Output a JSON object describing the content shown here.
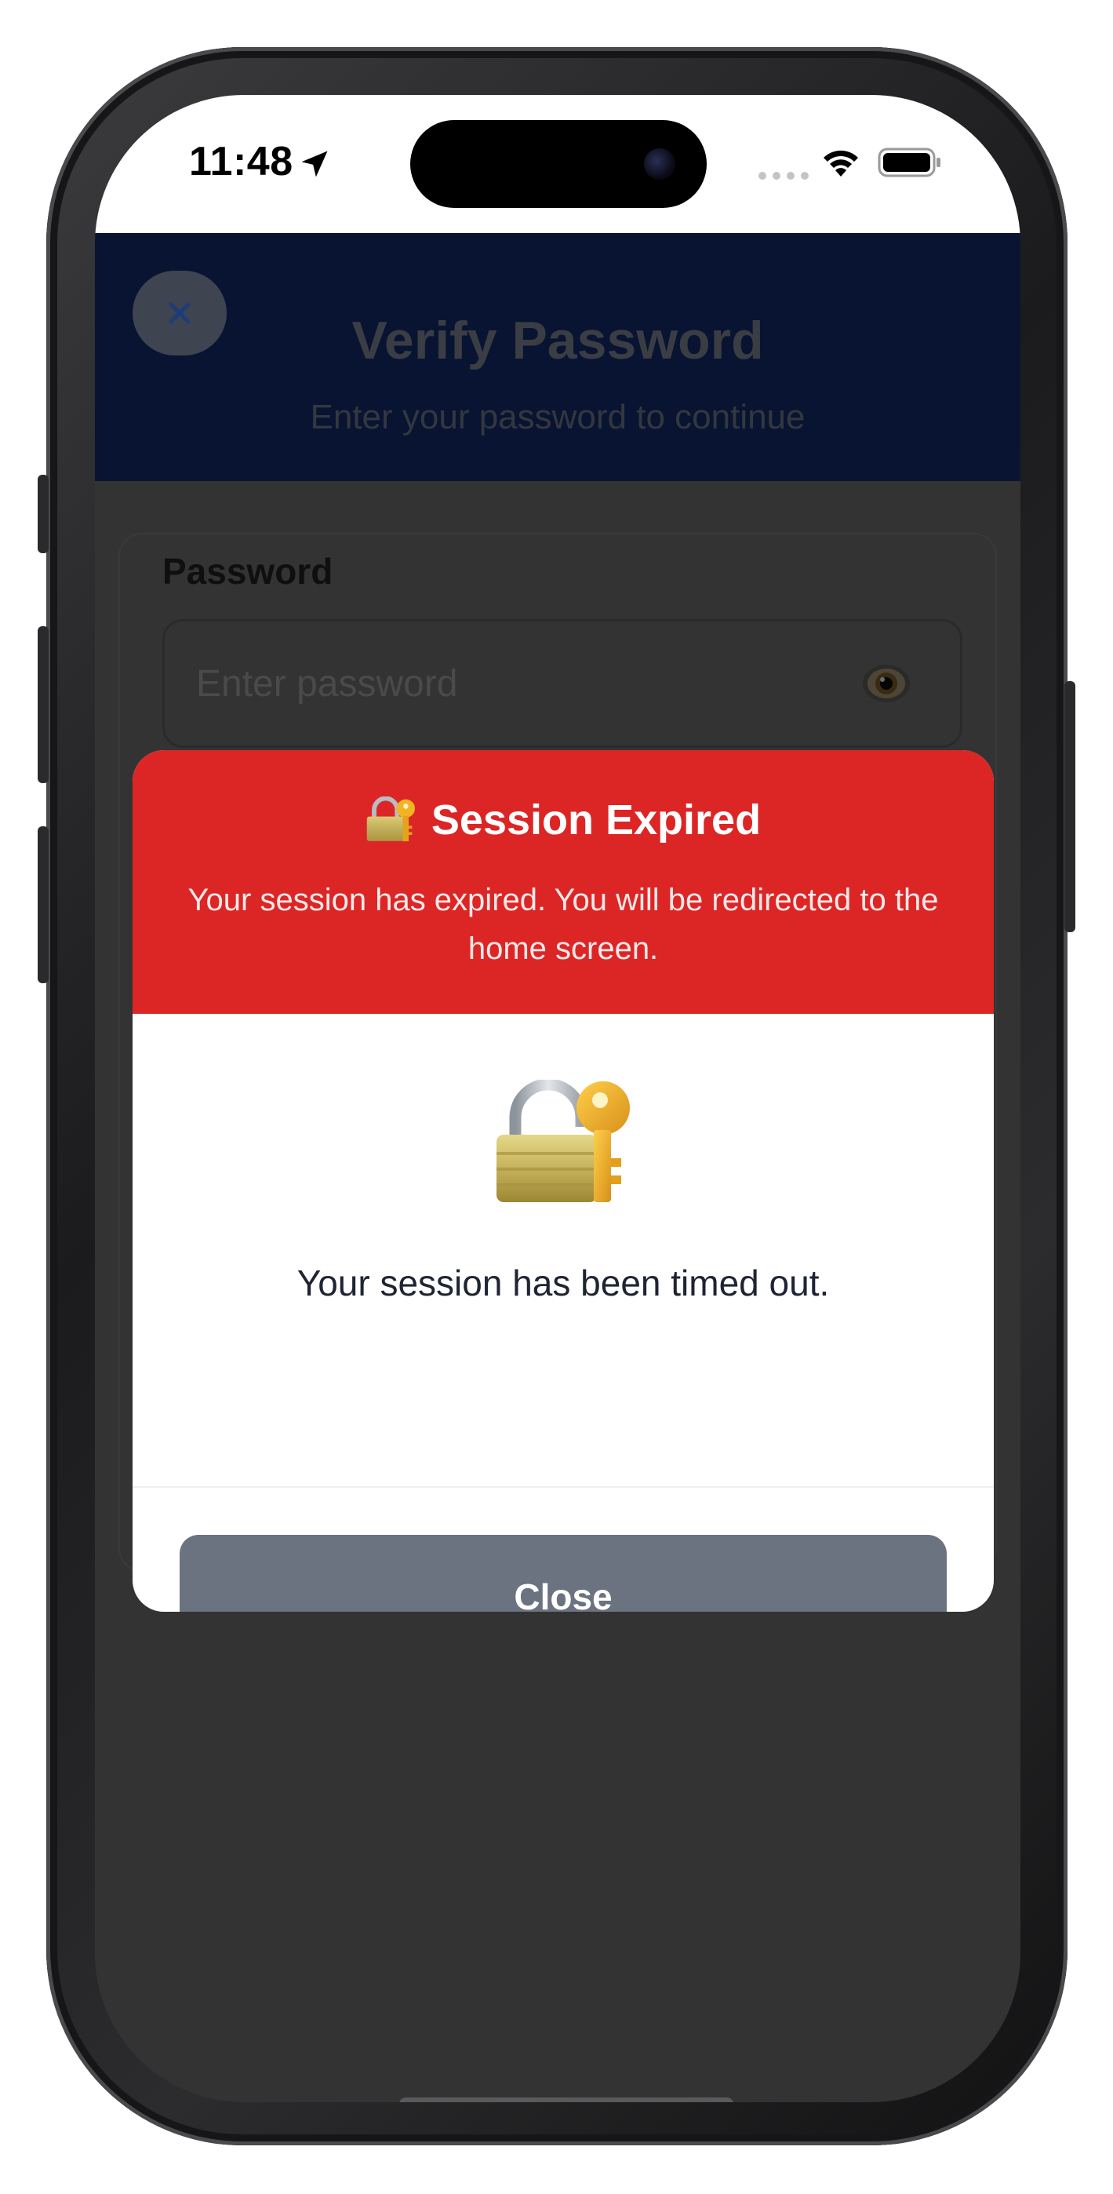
{
  "status_bar": {
    "time": "11:48",
    "icons": [
      "location-arrow-icon",
      "signal-dots-icon",
      "wifi-icon",
      "battery-icon"
    ]
  },
  "header": {
    "title": "Verify Password",
    "subtitle": "Enter your password to continue",
    "close_icon": "close-icon",
    "background": "#081431"
  },
  "form": {
    "password_label": "Password",
    "password_placeholder": "Enter password",
    "password_value": "",
    "toggle_visibility_icon": "eye-icon"
  },
  "modal": {
    "title_icon": "lock-with-key-icon",
    "title": "Session Expired",
    "message": "Your session has expired. You will be redirected to the home screen.",
    "illustration_icon": "lock-with-key-icon",
    "body_text": "Your session has been timed out.",
    "close_label": "Close",
    "header_color": "#dc2626",
    "button_color": "#6b7280"
  }
}
